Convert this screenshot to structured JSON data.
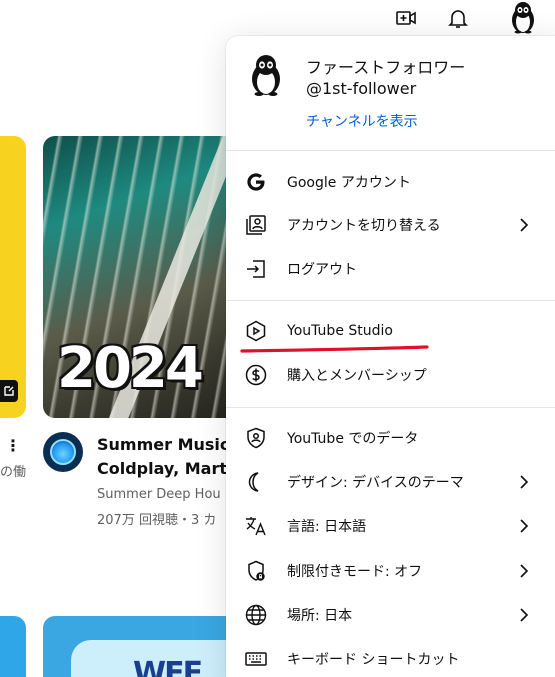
{
  "header": {
    "icons": [
      "create-video-icon",
      "notifications-bell-icon",
      "account-avatar-icon"
    ]
  },
  "background": {
    "thumbnail_text": "2024",
    "bottom_thumbnail_text": "WEF",
    "left_cut_text": "の働",
    "video": {
      "title_line1": "Summer Music M",
      "title_line2": "Coldplay, Martin",
      "channel": "Summer Deep Hou",
      "meta": "207万 回視聴・3 カ"
    }
  },
  "account_menu": {
    "name": "ファーストフォロワー",
    "handle": "@1st-follower",
    "view_channel": "チャンネルを表示",
    "items": [
      {
        "label": "Google アカウント",
        "icon": "google-icon",
        "has_chevron": false
      },
      {
        "label": "アカウントを切り替える",
        "icon": "switch-account-icon",
        "has_chevron": true
      },
      {
        "label": "ログアウト",
        "icon": "sign-out-icon",
        "has_chevron": false
      },
      {
        "label": "YouTube Studio",
        "icon": "youtube-studio-icon",
        "has_chevron": false
      },
      {
        "label": "購入とメンバーシップ",
        "icon": "dollar-icon",
        "has_chevron": false
      },
      {
        "label": "YouTube でのデータ",
        "icon": "shield-user-icon",
        "has_chevron": false
      },
      {
        "label": "デザイン: デバイスのテーマ",
        "icon": "moon-icon",
        "has_chevron": true
      },
      {
        "label": "言語: 日本語",
        "icon": "translate-icon",
        "has_chevron": true
      },
      {
        "label": "制限付きモード: オフ",
        "icon": "restricted-mode-icon",
        "has_chevron": true
      },
      {
        "label": "場所: 日本",
        "icon": "globe-icon",
        "has_chevron": true
      },
      {
        "label": "キーボード ショートカット",
        "icon": "keyboard-icon",
        "has_chevron": false
      }
    ]
  },
  "colors": {
    "link": "#065fd4",
    "annotation_underline": "#e0102a",
    "text": "#0f0f0f",
    "secondary_text": "#606060"
  }
}
